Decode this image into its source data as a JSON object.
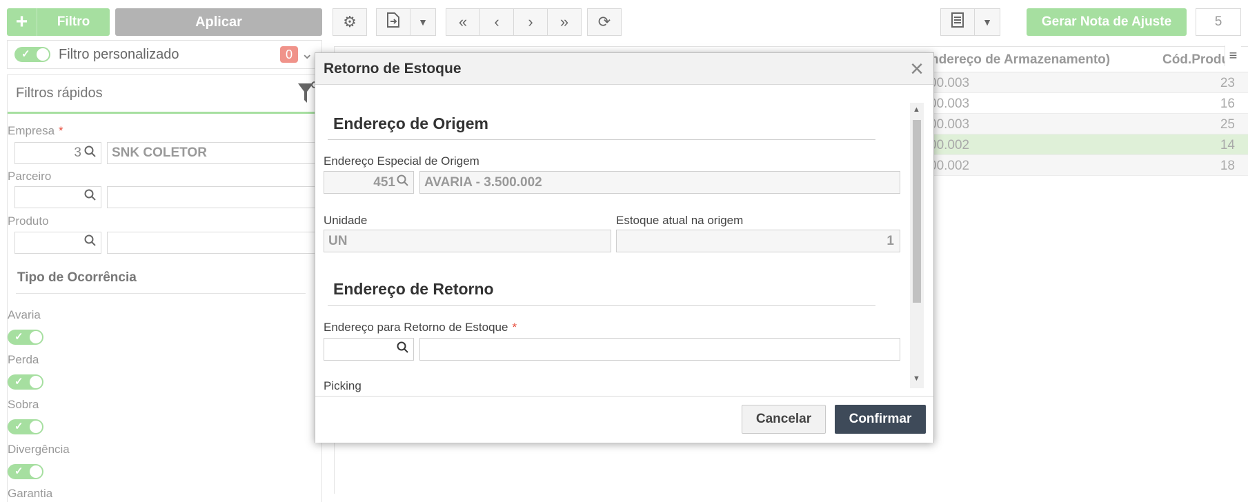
{
  "toolbar_left": {
    "add_icon": "plus-icon",
    "filtro_label": "Filtro",
    "aplicar_label": "Aplicar"
  },
  "custom_filter": {
    "label": "Filtro personalizado",
    "count": "0"
  },
  "quick_filters": {
    "title": "Filtros rápidos",
    "empresa_label": "Empresa",
    "empresa_code": "3",
    "empresa_name": "SNK COLETOR",
    "parceiro_label": "Parceiro",
    "produto_label": "Produto",
    "tipo_ocorrencia_title": "Tipo de Ocorrência",
    "occurrences": [
      {
        "label": "Avaria"
      },
      {
        "label": "Perda"
      },
      {
        "label": "Sobra"
      },
      {
        "label": "Divergência"
      },
      {
        "label": "Garantia"
      }
    ]
  },
  "toolbar_right": {
    "gerar_label": "Gerar Nota de Ajuste",
    "count": "5"
  },
  "grid": {
    "headers": [
      "ndereço de Armazenamento)",
      "Cód.Produ"
    ],
    "rows": [
      {
        "addr": "00.003",
        "cod": "23"
      },
      {
        "addr": "00.003",
        "cod": "16"
      },
      {
        "addr": "00.003",
        "cod": "25"
      },
      {
        "addr": "00.002",
        "cod": "14"
      },
      {
        "addr": "00.002",
        "cod": "18"
      }
    ],
    "selected_row_color": "#dff0d8"
  },
  "modal": {
    "title": "Retorno de Estoque",
    "origem_section": "Endereço de Origem",
    "end_especial_label": "Endereço Especial de Origem",
    "end_especial_code": "451",
    "end_especial_name": "AVARIA - 3.500.002",
    "unidade_label": "Unidade",
    "unidade_value": "UN",
    "estoque_label": "Estoque atual na origem",
    "estoque_value": "1",
    "retorno_section": "Endereço de Retorno",
    "end_retorno_label": "Endereço para Retorno de Estoque",
    "picking_label": "Picking",
    "cancel_label": "Cancelar",
    "confirm_label": "Confirmar"
  },
  "colors": {
    "accent_green": "#a6dfa0",
    "confirm_dark": "#3e4a59",
    "required_red": "#e74c3c"
  }
}
